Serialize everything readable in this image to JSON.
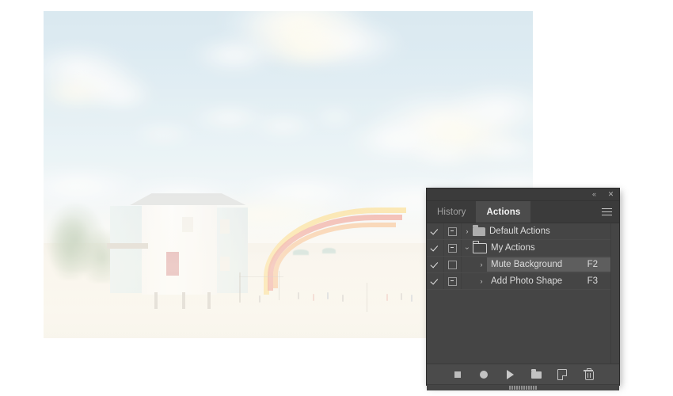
{
  "canvas": {
    "background_color": "#ffffff"
  },
  "photo": {
    "name": "beach-house-photo",
    "description": "Faded beach scene with stilt house, water slide, sand and sky",
    "alt": "Muted beach photograph"
  },
  "panel": {
    "titlebar": {
      "collapse_icon": "collapse-icon",
      "collapse_glyph": "«",
      "close_icon": "close-icon",
      "close_glyph": "✕"
    },
    "tabs": [
      {
        "label": "History",
        "active": false
      },
      {
        "label": "Actions",
        "active": true
      }
    ],
    "menu_icon": "hamburger-menu-icon",
    "rows": [
      {
        "toggle_checked": true,
        "dialog_box": "minus",
        "expander": "›",
        "expanded": false,
        "icon": "folder-closed-icon",
        "label": "Default Actions",
        "shortcut": "",
        "selected": false,
        "indented": false
      },
      {
        "toggle_checked": true,
        "dialog_box": "minus",
        "expander": "›",
        "expanded": true,
        "icon": "folder-open-icon",
        "label": "My Actions",
        "shortcut": "",
        "selected": false,
        "indented": false
      },
      {
        "toggle_checked": true,
        "dialog_box": "empty",
        "expander": "›",
        "expanded": false,
        "icon": "none",
        "label": "Mute Background",
        "shortcut": "F2",
        "selected": true,
        "indented": true
      },
      {
        "toggle_checked": true,
        "dialog_box": "minus",
        "expander": "›",
        "expanded": false,
        "icon": "none",
        "label": "Add Photo Shape",
        "shortcut": "F3",
        "selected": false,
        "indented": true
      }
    ],
    "footer_buttons": [
      {
        "name": "stop-button",
        "icon": "stop-icon"
      },
      {
        "name": "record-button",
        "icon": "record-icon"
      },
      {
        "name": "play-button",
        "icon": "play-icon"
      },
      {
        "name": "new-set-button",
        "icon": "folder-icon"
      },
      {
        "name": "new-action-button",
        "icon": "new-page-icon"
      },
      {
        "name": "delete-button",
        "icon": "trash-icon"
      }
    ],
    "colors": {
      "panel_bg": "#454545",
      "tab_bar_bg": "#3b3b3b",
      "tab_active_bg": "#4c4c4c",
      "footer_bg": "#4b4b4b",
      "selected_row_bg": "#5e5e5e",
      "text": "#dcdcdc"
    }
  }
}
